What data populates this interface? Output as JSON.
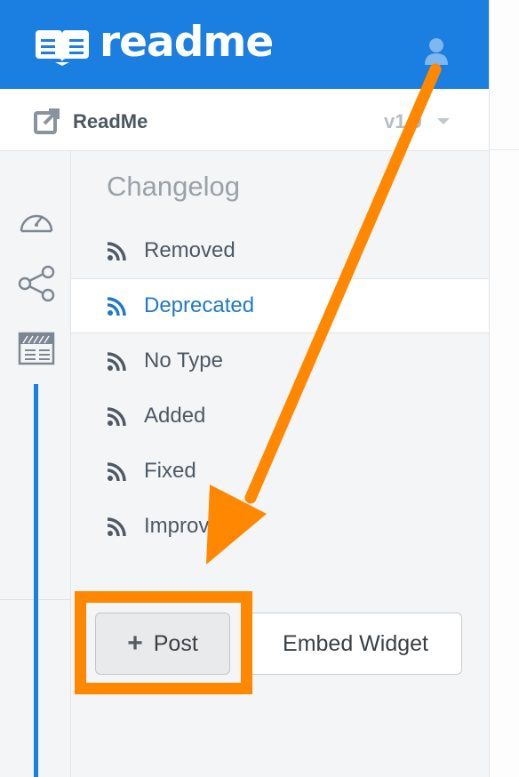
{
  "header": {
    "brand": "readme",
    "logo_icon": "book-icon",
    "user_icon": "user-icon",
    "color": "#1a7fe0"
  },
  "project": {
    "name": "ReadMe",
    "version": "v1.0",
    "external_icon": "external-link-icon"
  },
  "rail": {
    "icons": [
      "dashboard-gauge-icon",
      "share-icon",
      "browser-window-icon"
    ]
  },
  "changelog": {
    "title": "Changelog",
    "items": [
      {
        "label": "Removed",
        "icon": "rss-icon"
      },
      {
        "label": "Deprecated",
        "icon": "rss-icon",
        "active": true
      },
      {
        "label": "No Type",
        "icon": "rss-icon"
      },
      {
        "label": "Added",
        "icon": "rss-icon"
      },
      {
        "label": "Fixed",
        "icon": "rss-icon"
      },
      {
        "label": "Improved",
        "icon": "rss-icon"
      }
    ]
  },
  "actions": {
    "post_label": "Post",
    "post_icon": "plus-icon",
    "embed_label": "Embed Widget"
  },
  "annotation": {
    "arrow_color": "#ff8800",
    "highlight_color": "#ff8800"
  }
}
